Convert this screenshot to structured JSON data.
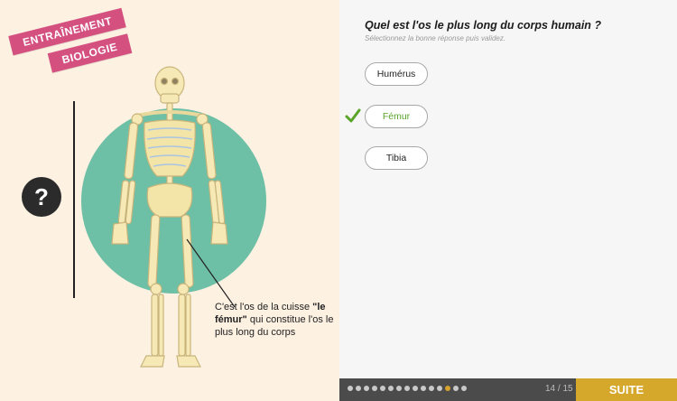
{
  "badge": {
    "line1": "ENTRAÎNEMENT",
    "line2": "BIOLOGIE"
  },
  "help": {
    "symbol": "?"
  },
  "caption": {
    "before": "C'est l'os de la cuisse ",
    "bold": "\"le fémur\"",
    "after": " qui constitue l'os le plus long du corps"
  },
  "question": {
    "title": "Quel est l'os le plus long du corps humain ?",
    "subtitle": "Sélectionnez la bonne réponse puis validez.",
    "answers": [
      "Humérus",
      "Fémur",
      "Tibia"
    ]
  },
  "progress": {
    "counter": "14 / 15",
    "current_index": 12,
    "total_dots": 15
  },
  "actions": {
    "next_label": "SUITE"
  },
  "colors": {
    "accent": "#d5a72a",
    "correct": "#5aa42a",
    "badge": "#d4517f",
    "circle": "#6dbfa6"
  }
}
